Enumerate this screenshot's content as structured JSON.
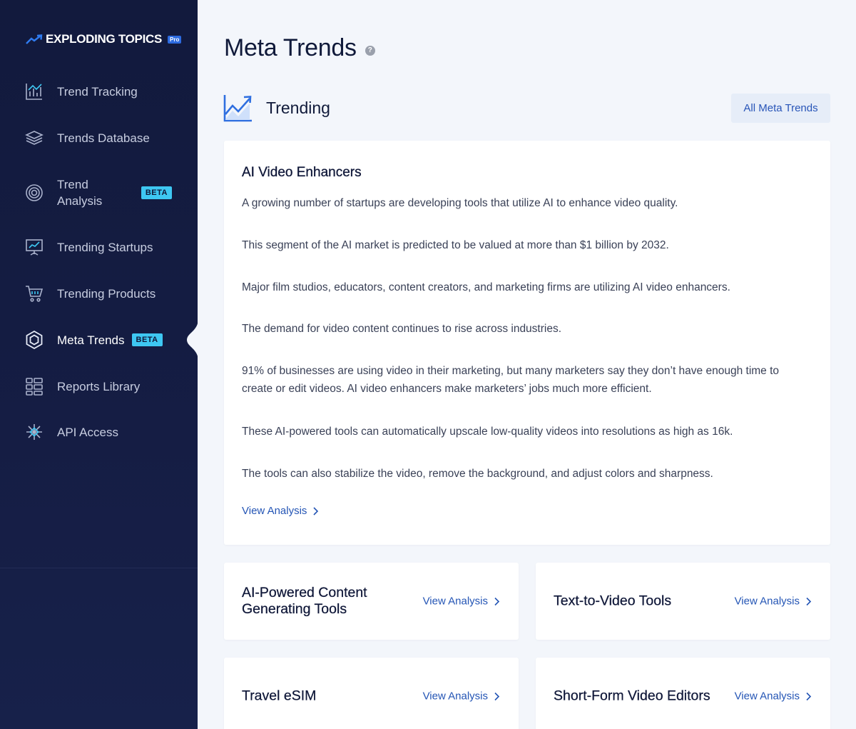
{
  "brand": {
    "name": "EXPLODING TOPICS",
    "tier": "Pro"
  },
  "nav": {
    "items": [
      {
        "label": "Trend Tracking"
      },
      {
        "label": "Trends Database"
      },
      {
        "label": "Trend\nAnalysis",
        "badge": "BETA"
      },
      {
        "label": "Trending Startups"
      },
      {
        "label": "Trending Products"
      },
      {
        "label": "Meta Trends",
        "badge": "BETA",
        "active": true
      },
      {
        "label": "Reports Library"
      },
      {
        "label": "API Access"
      }
    ]
  },
  "page": {
    "title": "Meta Trends",
    "help": "?"
  },
  "section": {
    "title": "Trending",
    "all_button": "All Meta Trends"
  },
  "featured": {
    "title": "AI Video Enhancers",
    "paragraphs": [
      "A growing number of startups are developing tools that utilize AI to enhance video quality.",
      "This segment of the AI market is predicted to be valued at more than $1 billion by 2032.",
      "Major film studios, educators, content creators, and marketing firms are utilizing AI video enhancers.",
      "The demand for video content continues to rise across industries.",
      "91% of businesses are using video in their marketing, but many marketers say they don’t have enough time to create or edit videos. AI video enhancers make marketers’ jobs much more efficient.",
      "These AI-powered tools can automatically upscale low-quality videos into resolutions as high as 16k.",
      "The tools can also stabilize the video, remove the background, and adjust colors and sharpness."
    ],
    "link": "View Analysis"
  },
  "cards": [
    {
      "title": "AI-Powered Content Generating Tools",
      "link": "View Analysis"
    },
    {
      "title": "Text-to-Video Tools",
      "link": "View Analysis"
    },
    {
      "title": "Travel eSIM",
      "link": "View Analysis"
    },
    {
      "title": "Short-Form Video Editors",
      "link": "View Analysis"
    }
  ],
  "colors": {
    "sidebar": "#121a3d",
    "accent": "#2455b5",
    "badge": "#3ec7f2"
  }
}
